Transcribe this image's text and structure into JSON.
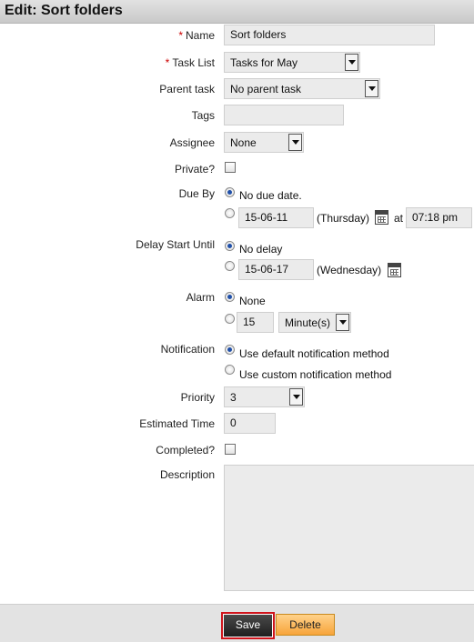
{
  "header": {
    "title": "Edit: Sort folders"
  },
  "form": {
    "name": {
      "label": "Name",
      "value": "Sort folders"
    },
    "task_list": {
      "label": "Task List",
      "value": "Tasks for May"
    },
    "parent_task": {
      "label": "Parent task",
      "value": "No parent task"
    },
    "tags": {
      "label": "Tags",
      "value": ""
    },
    "assignee": {
      "label": "Assignee",
      "value": "None"
    },
    "private": {
      "label": "Private?"
    },
    "due_by": {
      "label": "Due By",
      "option_none": "No due date.",
      "date": "15-06-11",
      "weekday": "(Thursday)",
      "at": "at",
      "time": "07:18 pm"
    },
    "delay_start": {
      "label": "Delay Start Until",
      "option_none": "No delay",
      "date": "15-06-17",
      "weekday": "(Wednesday)"
    },
    "alarm": {
      "label": "Alarm",
      "option_none": "None",
      "amount": "15",
      "unit": "Minute(s)"
    },
    "notification": {
      "label": "Notification",
      "option_default": "Use default notification method",
      "option_custom": "Use custom notification method"
    },
    "priority": {
      "label": "Priority",
      "value": "3"
    },
    "estimated_time": {
      "label": "Estimated Time",
      "value": "0"
    },
    "completed": {
      "label": "Completed?"
    },
    "description": {
      "label": "Description",
      "value": ""
    }
  },
  "footer": {
    "save_label": "Save",
    "delete_label": "Delete"
  },
  "colors": {
    "required_marker": "#cc0000",
    "save_highlight": "#d0141c",
    "delete_button": "#f7a43a",
    "radio_selected": "#1f4fa8"
  }
}
